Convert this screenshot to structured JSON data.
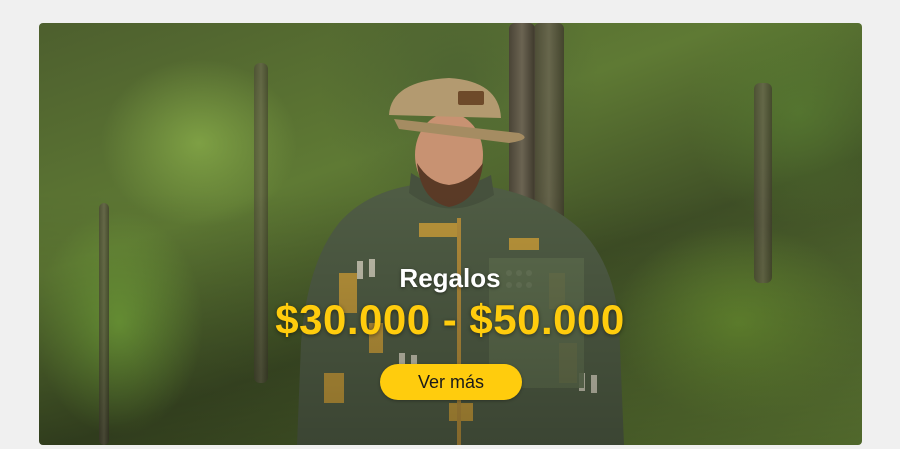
{
  "banner": {
    "image_alt": "man wearing cap and patterned fleece jacket in forest",
    "title": "Regalos",
    "price_range": "$30.000 - $50.000",
    "cta_label": "Ver más"
  },
  "colors": {
    "page_background": "#f0f0f0",
    "accent_yellow": "#ffcc0d",
    "title_white": "#ffffff",
    "button_text": "#1a1a1a"
  }
}
